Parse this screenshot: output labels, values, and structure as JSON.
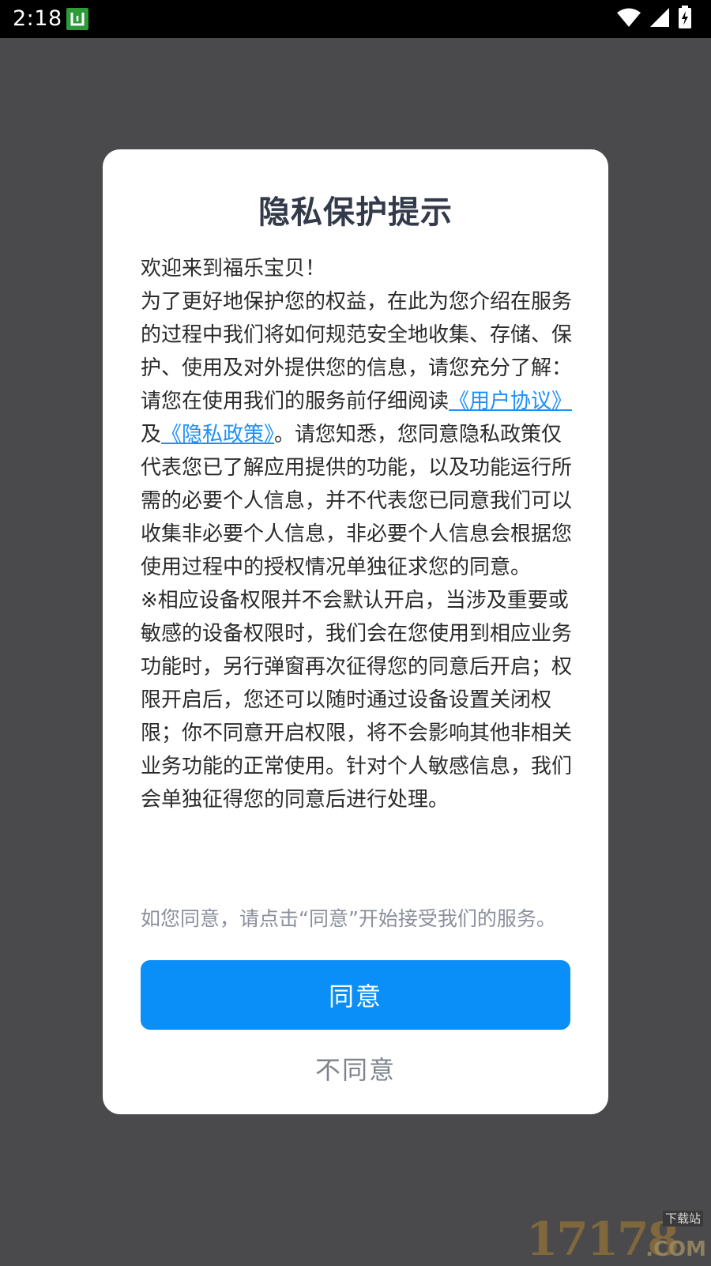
{
  "status_bar": {
    "time": "2:18",
    "notification_icon": "app-notification-icon",
    "icons": [
      "wifi-icon",
      "signal-icon",
      "battery-charging-icon"
    ]
  },
  "dialog": {
    "title": "隐私保护提示",
    "welcome": "欢迎来到福乐宝贝！",
    "intro": "为了更好地保护您的权益，在此为您介绍在服务的过程中我们将如何规范安全地收集、存储、保护、使用及对外提供您的信息，请您充分了解：",
    "read_prefix": "请您在使用我们的服务前仔细阅读",
    "user_agreement_link": "《用户协议》",
    "and": "及",
    "privacy_policy_link": "《隐私政策》",
    "read_suffix": "。请您知悉，您同意隐私政策仅代表您已了解应用提供的功能，以及功能运行所需的必要个人信息，并不代表您已同意我们可以收集非必要个人信息，非必要个人信息会根据您使用过程中的授权情况单独征求您的同意。",
    "permissions_note": "※相应设备权限并不会默认开启，当涉及重要或敏感的设备权限时，我们会在您使用到相应业务功能时，另行弹窗再次征得您的同意后开启；权限开启后，您还可以随时通过设备设置关闭权限；你不同意开启权限，将不会影响其他非相关业务功能的正常使用。针对个人敏感信息，我们会单独征得您的同意后进行处理。",
    "hint": "如您同意，请点击“同意”开始接受我们的服务。",
    "agree_label": "同意",
    "disagree_label": "不同意"
  },
  "watermark": {
    "digits": "17178",
    "sub": "下载站",
    "com": ".COM"
  },
  "colors": {
    "overlay": "#4a4a4c",
    "accent": "#0a8ef8",
    "link": "#1e8ff6",
    "title": "#333a4a",
    "hint": "#8a8f9c"
  }
}
